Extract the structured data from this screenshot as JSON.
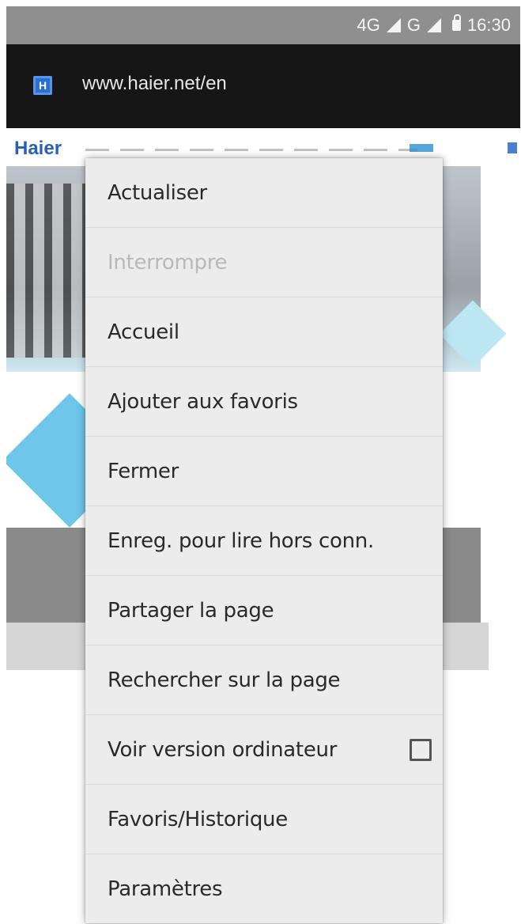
{
  "status_bar": {
    "network": "4G",
    "network2": "G",
    "time": "16:30",
    "icons": [
      "signal-4g-icon",
      "signal-g-icon",
      "lock-icon"
    ]
  },
  "browser": {
    "url": "www.haier.net/en",
    "favicon": "H"
  },
  "page": {
    "logo": "Haier"
  },
  "menu": {
    "items": [
      {
        "label": "Actualiser",
        "enabled": true
      },
      {
        "label": "Interrompre",
        "enabled": false
      },
      {
        "label": "Accueil",
        "enabled": true
      },
      {
        "label": "Ajouter aux favoris",
        "enabled": true
      },
      {
        "label": "Fermer",
        "enabled": true
      },
      {
        "label": "Enreg. pour lire hors conn.",
        "enabled": true
      },
      {
        "label": "Partager la page",
        "enabled": true
      },
      {
        "label": "Rechercher sur la page",
        "enabled": true
      },
      {
        "label": "Voir version ordinateur",
        "enabled": true,
        "checkbox": false
      },
      {
        "label": "Favoris/Historique",
        "enabled": true
      },
      {
        "label": "Paramètres",
        "enabled": true
      }
    ]
  }
}
